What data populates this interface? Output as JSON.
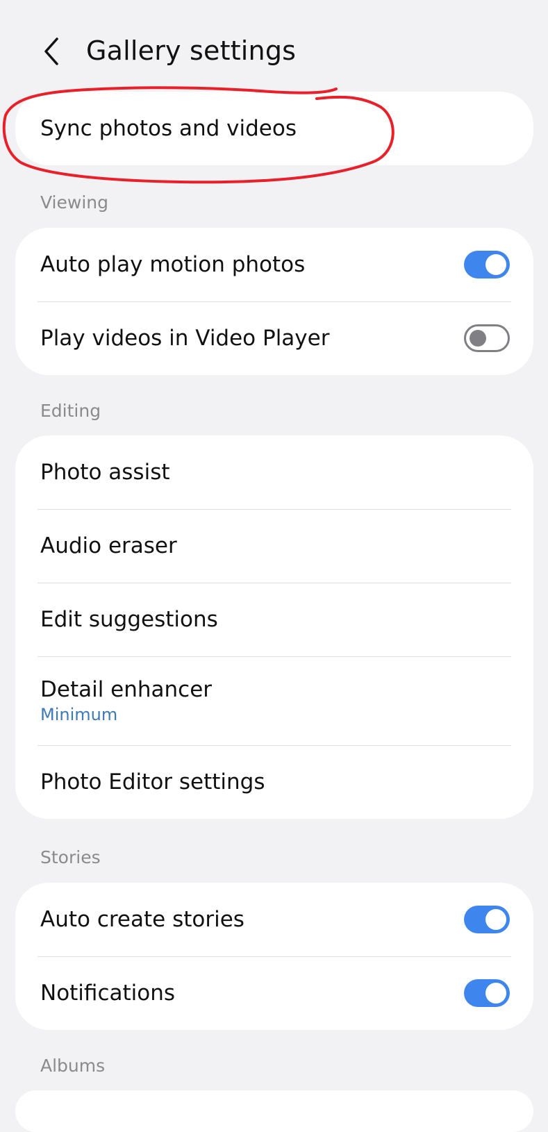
{
  "header": {
    "title": "Gallery settings",
    "back_icon": "chevron-left-icon"
  },
  "sync": {
    "label": "Sync photos and videos"
  },
  "viewing": {
    "title": "Viewing",
    "items": [
      {
        "label": "Auto play motion photos",
        "toggle": true
      },
      {
        "label": "Play videos in Video Player",
        "toggle": false
      }
    ]
  },
  "editing": {
    "title": "Editing",
    "items": [
      {
        "label": "Photo assist"
      },
      {
        "label": "Audio eraser"
      },
      {
        "label": "Edit suggestions"
      },
      {
        "label": "Detail enhancer",
        "sublabel": "Minimum"
      },
      {
        "label": "Photo Editor settings"
      }
    ]
  },
  "stories": {
    "title": "Stories",
    "items": [
      {
        "label": "Auto create stories",
        "toggle": true
      },
      {
        "label": "Notifications",
        "toggle": true
      }
    ]
  },
  "albums": {
    "title": "Albums"
  },
  "colors": {
    "background": "#f2f2f4",
    "card": "#ffffff",
    "accent": "#3e86ee",
    "sublabel": "#3d7ab8",
    "annotation": "#e8202a"
  }
}
